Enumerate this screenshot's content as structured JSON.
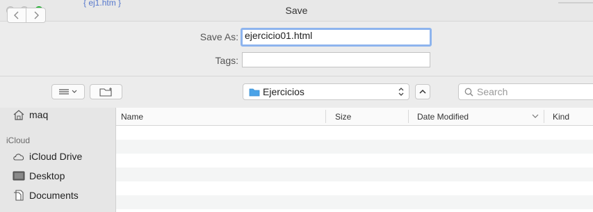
{
  "window": {
    "title": "Save",
    "background_glimpse": "{ ej1.htm }"
  },
  "form": {
    "save_as_label": "Save As:",
    "save_as_value": "ejercicio01.html",
    "tags_label": "Tags:",
    "tags_value": ""
  },
  "toolbar": {
    "location": "Ejercicios",
    "search_placeholder": "Search"
  },
  "sidebar": {
    "home_item": "maq",
    "section_icloud": "iCloud",
    "items": [
      "iCloud Drive",
      "Desktop",
      "Documents"
    ]
  },
  "columns": [
    "Name",
    "Size",
    "Date Modified",
    "Kind"
  ],
  "colors": {
    "accent_focus": "#8db4ee",
    "folder_blue": "#4aa3e8",
    "zoom_green": "#2cc43b"
  }
}
